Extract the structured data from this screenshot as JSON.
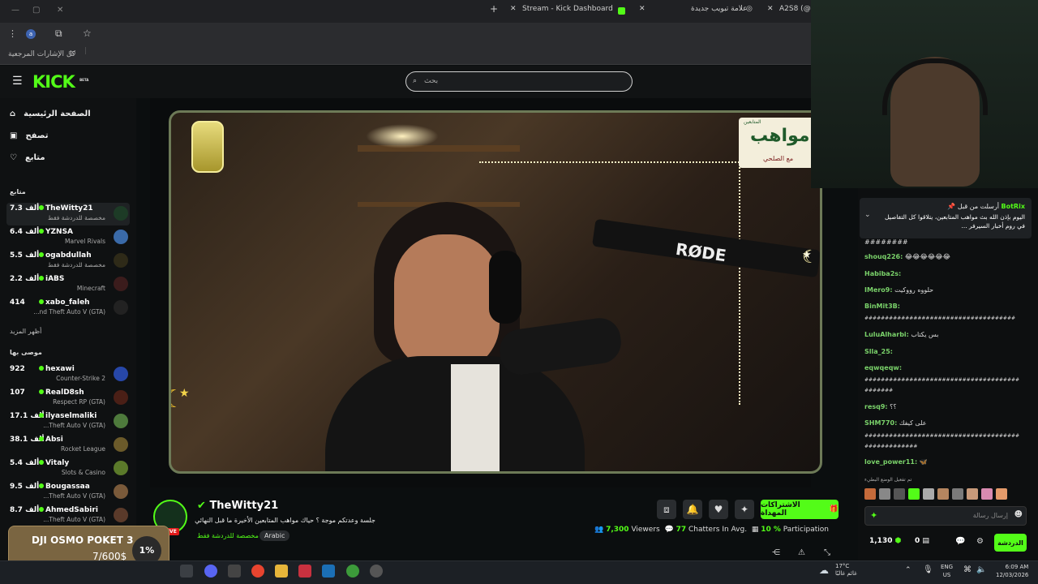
{
  "browser": {
    "tabs": [
      {
        "label": "Stream - Kick Dashboard"
      },
      {
        "label": "علامة تبويب جديدة"
      },
      {
        "label": "A2S8 (@a2"
      }
    ],
    "bookmarks_label": "كل الإشارات المرجعية",
    "profile_initial": "a"
  },
  "kick": {
    "logo": "KICK",
    "logo_badge": "BETA",
    "search_placeholder": "بحث"
  },
  "sidebar": {
    "nav": [
      {
        "label": "الصفحة الرئيسية",
        "icon": "home-icon"
      },
      {
        "label": "تصفح",
        "icon": "browse-icon"
      },
      {
        "label": "متابع",
        "icon": "heart-icon"
      }
    ],
    "following_header": "متابع",
    "following": [
      {
        "viewers": "7.3 ألف",
        "name": "TheWitty21",
        "category": "مخصصة للدردشة فقط"
      },
      {
        "viewers": "6.4 ألف",
        "name": "YZNSA",
        "category": "Marvel Rivals"
      },
      {
        "viewers": "5.5 ألف",
        "name": "ogabdullah",
        "category": "مخصصة للدردشة فقط"
      },
      {
        "viewers": "2.2 ألف",
        "name": "iABS",
        "category": "Minecraft"
      },
      {
        "viewers": "414",
        "name": "xabo_faleh",
        "category": "...nd Theft Auto V (GTA)"
      }
    ],
    "show_more": "أظهر المزيد",
    "recommended_header": "موصى بها",
    "recommended": [
      {
        "viewers": "922",
        "name": "hexawi",
        "category": "Counter-Strike 2"
      },
      {
        "viewers": "107",
        "name": "RealD8sh",
        "category": "Respect RP (GTA)"
      },
      {
        "viewers": "17.1 ألف",
        "name": "ilyaselmaliki",
        "category": "...Theft Auto V (GTA)"
      },
      {
        "viewers": "38.1 ألف",
        "name": "Absi",
        "category": "Rocket League"
      },
      {
        "viewers": "5.4 ألف",
        "name": "Vitaly",
        "category": "Slots & Casino"
      },
      {
        "viewers": "9.5 ألف",
        "name": "Bougassaa",
        "category": "...Theft Auto V (GTA)"
      },
      {
        "viewers": "8.7 ألف",
        "name": "AhmedSabiri",
        "category": "...Theft Auto V (GTA)"
      }
    ]
  },
  "video": {
    "mic_brand": "RØDE",
    "banner_title": "مواهب",
    "banner_sub": "مع الصلحي",
    "banner_top": "المتابعين"
  },
  "stream": {
    "channel": "TheWitty21",
    "title": "جلسة وعدتكم موجة ؟ حياك مواهب المتابعين الأخيرة ما قبل النهائي",
    "tag_category": "مخصصة للدردشة فقط",
    "tag_language": "Arabic",
    "live": "LIVE",
    "subscribe_label": "الاشتراكات المهداة",
    "viewers": "7,300",
    "viewers_label": "Viewers",
    "chatters": "77",
    "chatters_label": "Chatters In Avg.",
    "participation": "10 %",
    "participation_label": "Participation"
  },
  "chat": {
    "pinned_user": "BotRix",
    "pinned_by": "أرسلت من قبل",
    "pinned_text": "اليوم بإذن الله بث مواهب المتابعين، يتلاقوا كل التفاصيل في روم أخبار السيرفر ...",
    "messages": [
      {
        "user": "",
        "text": "########"
      },
      {
        "user": "shouq226:",
        "text": "😂😂😂😂😂😂"
      },
      {
        "user": "Habiba2s:",
        "text": ""
      },
      {
        "user": "IMero9:",
        "text": "حلووه رووكيت"
      },
      {
        "user": "BinMit3B:",
        "text": ""
      },
      {
        "user": "",
        "text": "#####################################"
      },
      {
        "user": "LuluAlharbi:",
        "text": "بس يكتاب"
      },
      {
        "user": "Slla_25:",
        "text": ""
      },
      {
        "user": "eqwqeqw:",
        "text": ""
      },
      {
        "user": "",
        "text": "######################################"
      },
      {
        "user": "",
        "text": "#######"
      },
      {
        "user": "resq9:",
        "text": "؟؟"
      },
      {
        "user": "SHM770:",
        "text": "على كيفك"
      },
      {
        "user": "",
        "text": "######################################"
      },
      {
        "user": "",
        "text": "#############"
      },
      {
        "user": "love_power11:",
        "text": "🦋"
      }
    ],
    "slow_mode_note": "تم تفعيل الوضع البطيء",
    "input_placeholder": "إرسال رسالة",
    "points": "1,130",
    "points2": "0",
    "send_label": "الدردشة"
  },
  "overlay": {
    "donation_title": "DJI OSMO POKET 3",
    "donation_amount": "7/600$",
    "donation_percent": "1%"
  },
  "taskbar": {
    "weather_temp": "17°C",
    "weather_text": "غائم غالبًا",
    "lang": "ENG",
    "region": "US",
    "time": "6:09 AM",
    "date": "12/03/2026"
  }
}
